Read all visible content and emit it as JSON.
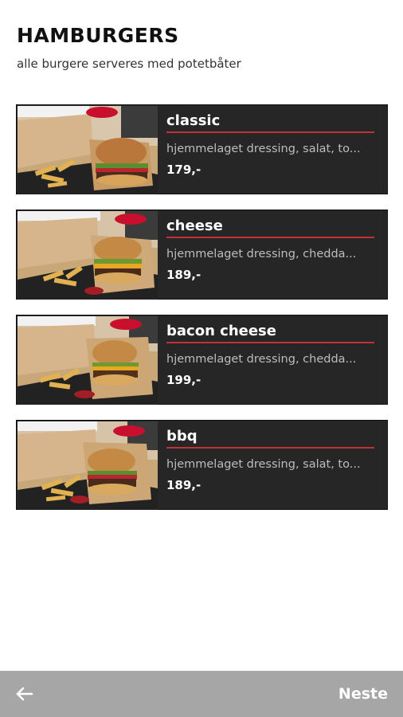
{
  "header": {
    "title": "HAMBURGERS",
    "subtitle": "alle burgere serveres med potetbåter"
  },
  "items": [
    {
      "name": "classic",
      "description": "hjemmelaget dressing, salat, to...",
      "price": "179,-",
      "image": "classic-burger-photo"
    },
    {
      "name": "cheese",
      "description": "hjemmelaget dressing, chedda...",
      "price": "189,-",
      "image": "cheese-burger-photo"
    },
    {
      "name": "bacon cheese",
      "description": "hjemmelaget dressing, chedda...",
      "price": "199,-",
      "image": "bacon-cheese-burger-photo"
    },
    {
      "name": "bbq",
      "description": "hjemmelaget dressing, salat, to...",
      "price": "189,-",
      "image": "bbq-burger-photo"
    }
  ],
  "footer": {
    "back_icon": "arrow-left-icon",
    "next_label": "Neste"
  },
  "colors": {
    "card_background": "#262626",
    "accent_underline": "#c0313a",
    "footer_background": "#a6a6a6"
  }
}
